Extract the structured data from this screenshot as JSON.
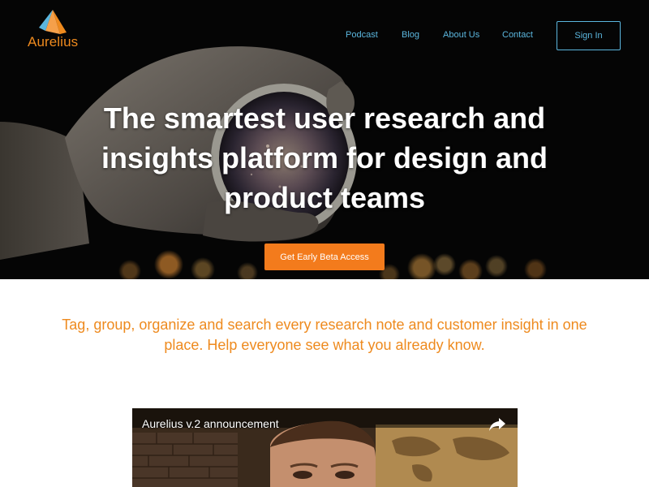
{
  "brand": {
    "name": "Aurelius",
    "accent": "#ee8a1e",
    "link_color": "#5bb6de"
  },
  "nav": {
    "items": [
      {
        "label": "Podcast"
      },
      {
        "label": "Blog"
      },
      {
        "label": "About Us"
      },
      {
        "label": "Contact"
      }
    ],
    "signin_label": "Sign In"
  },
  "hero": {
    "headline": "The smartest user research and insights platform for design and product teams",
    "cta_label": "Get Early Beta Access",
    "cta_color": "#f37b1c",
    "image": "gloved-hand-holding-galaxy-lens"
  },
  "tagline": "Tag, group, organize and search every research note and customer insight in one place. Help everyone see what you already know.",
  "video": {
    "title": "Aurelius v.2 announcement",
    "share_icon": "share-icon"
  }
}
